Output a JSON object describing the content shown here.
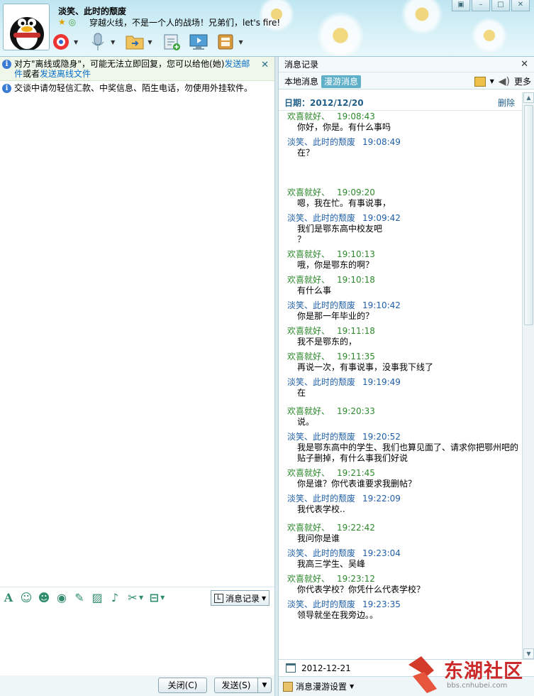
{
  "header": {
    "nickname": "淡笑、此时的颓废",
    "signature": "穿越火线，不是一个人的战场！兄弟们，let's fire!"
  },
  "left": {
    "notice1": {
      "text_before": "对方\"离线或隐身\"，可能无法立即回复，您可以给他(她)",
      "link_email": "发送邮件",
      "text_or": "或者",
      "link_offline": "发送离线文件"
    },
    "notice2": "交谈中请勿轻信汇款、中奖信息、陌生电话，勿使用外挂软件。",
    "history_button": "消息记录",
    "close_button": "关闭(C)",
    "send_button": "发送(S)"
  },
  "right": {
    "title": "消息记录",
    "tab_local": "本地消息",
    "tab_roam": "漫游消息",
    "more": "更多",
    "date_label": "日期：2012/12/20",
    "delete": "删除",
    "date_value": "2012-12-21",
    "roam_settings": "消息漫游设置",
    "messages": [
      {
        "sender": "欢喜就好、",
        "time": "19:08:43",
        "type": "friend",
        "text": "你好，你是。有什么事吗"
      },
      {
        "sender": "淡笑、此时的颓废",
        "time": "19:08:49",
        "type": "me",
        "text": "在？"
      },
      {
        "sender": "欢喜就好、",
        "time": "19:09:20",
        "type": "friend",
        "text": "嗯，我在忙。有事说事，"
      },
      {
        "sender": "淡笑、此时的颓废",
        "time": "19:09:42",
        "type": "me",
        "text": "我们是鄂东高中校友吧\n？"
      },
      {
        "sender": "欢喜就好、",
        "time": "19:10:13",
        "type": "friend",
        "text": "哦，你是鄂东的啊？"
      },
      {
        "sender": "欢喜就好、",
        "time": "19:10:18",
        "type": "friend",
        "text": "有什么事"
      },
      {
        "sender": "淡笑、此时的颓废",
        "time": "19:10:42",
        "type": "me",
        "text": "你是那一年毕业的？"
      },
      {
        "sender": "欢喜就好、",
        "time": "19:11:18",
        "type": "friend",
        "text": "我不是鄂东的，"
      },
      {
        "sender": "欢喜就好、",
        "time": "19:11:35",
        "type": "friend",
        "text": "再说一次，有事说事，没事我下线了"
      },
      {
        "sender": "淡笑、此时的颓废",
        "time": "19:19:49",
        "type": "me",
        "text": "在"
      },
      {
        "sender": "欢喜就好、",
        "time": "19:20:33",
        "type": "friend",
        "text": "说。"
      },
      {
        "sender": "淡笑、此时的颓废",
        "time": "19:20:52",
        "type": "me",
        "text": "我是鄂东高中的学生、我们也算见面了、请求你把鄂州吧的\n贴子删掉，有什么事我们好说"
      },
      {
        "sender": "欢喜就好、",
        "time": "19:21:45",
        "type": "friend",
        "text": "你是谁？你代表谁要求我删帖？"
      },
      {
        "sender": "淡笑、此时的颓废",
        "time": "19:22:09",
        "type": "me",
        "text": "我代表学校.."
      },
      {
        "sender": "欢喜就好、",
        "time": "19:22:42",
        "type": "friend",
        "text": "我问你是谁"
      },
      {
        "sender": "淡笑、此时的颓废",
        "time": "19:23:04",
        "type": "me",
        "text": "我高三学生、吴峰"
      },
      {
        "sender": "欢喜就好、",
        "time": "19:23:12",
        "type": "friend",
        "text": "你代表学校？你凭什么代表学校？"
      },
      {
        "sender": "淡笑、此时的颓废",
        "time": "19:23:35",
        "type": "me",
        "text": "领导就坐在我旁边。。"
      }
    ]
  },
  "watermark": {
    "text": "东湖社区",
    "url": "bbs.cnhubei.com"
  },
  "colors": {
    "friend": "#2d8a2d",
    "me": "#1f5fa8",
    "link": "#0a6ec8",
    "watermark": "#cc2a2a"
  }
}
